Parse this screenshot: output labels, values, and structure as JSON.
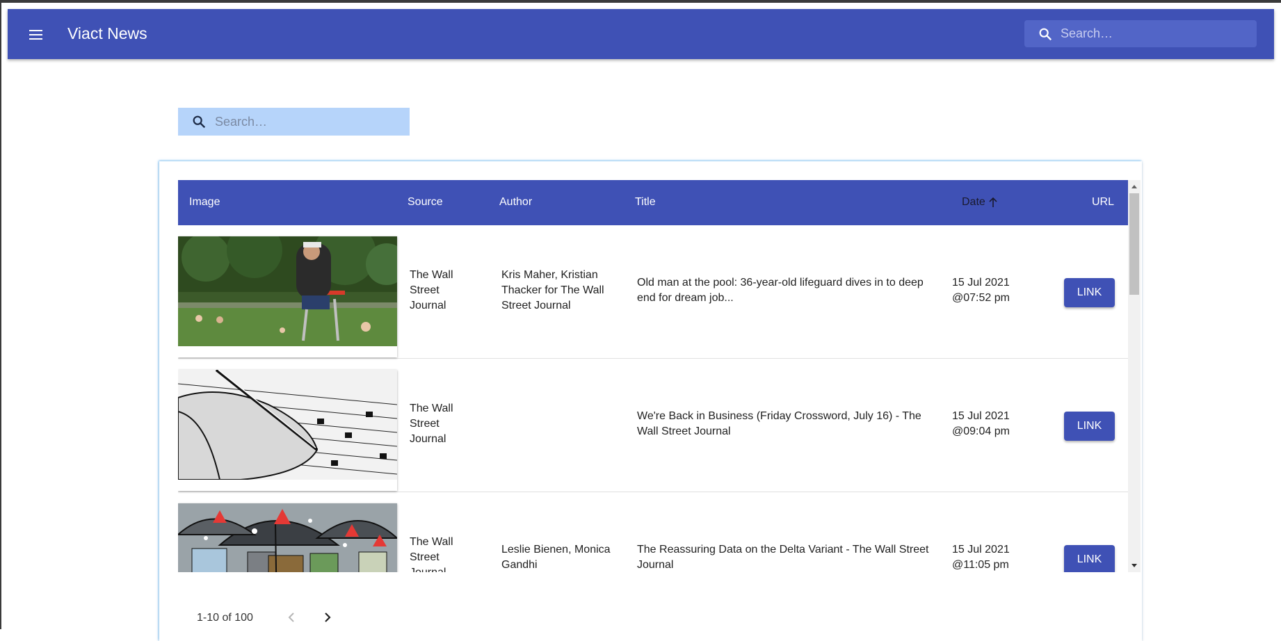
{
  "app": {
    "title": "Viact News",
    "search_placeholder": "Search…"
  },
  "content": {
    "search_placeholder": "Search…"
  },
  "table": {
    "columns": {
      "image": "Image",
      "source": "Source",
      "author": "Author",
      "title": "Title",
      "date": "Date",
      "url": "URL"
    },
    "rows": [
      {
        "source": "The Wall Street Journal",
        "author": "Kris Maher, Kristian Thacker for The Wall Street Journal",
        "title": "Old man at the pool: 36-year-old lifeguard dives in to deep end for dream job...",
        "date": "15 Jul 2021",
        "time": "@07:52 pm",
        "link_label": "LINK"
      },
      {
        "source": "The Wall Street Journal",
        "author": "",
        "title": "We're Back in Business (Friday Crossword, July 16) - The Wall Street Journal",
        "date": "15 Jul 2021",
        "time": "@09:04 pm",
        "link_label": "LINK"
      },
      {
        "source": "The Wall Street Journal",
        "author": "Leslie Bienen, Monica Gandhi",
        "title": "The Reassuring Data on the Delta Variant - The Wall Street Journal",
        "date": "15 Jul 2021",
        "time": "@11:05 pm",
        "link_label": "LINK"
      }
    ]
  },
  "pagination": {
    "range": "1-10 of 100"
  },
  "colors": {
    "primary": "#3f51b5",
    "search_bg": "#b6d4fa"
  }
}
